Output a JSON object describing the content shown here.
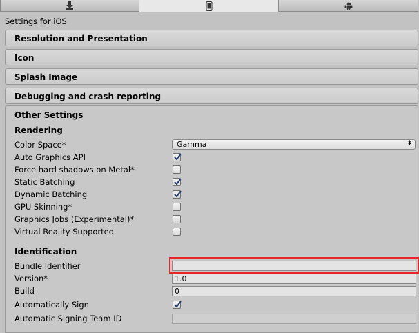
{
  "tabs": [
    {
      "icon": "download-icon"
    },
    {
      "icon": "mobile-phone-icon",
      "active": true
    },
    {
      "icon": "android-icon"
    }
  ],
  "title": "Settings for iOS",
  "sections": {
    "resolution": "Resolution and Presentation",
    "icon": "Icon",
    "splash": "Splash Image",
    "debugging": "Debugging and crash reporting",
    "other": "Other Settings"
  },
  "rendering": {
    "heading": "Rendering",
    "color_space_label": "Color Space*",
    "color_space_value": "Gamma",
    "items": [
      {
        "label": "Auto Graphics API",
        "checked": true
      },
      {
        "label": "Force hard shadows on Metal*",
        "checked": false
      },
      {
        "label": "Static Batching",
        "checked": true
      },
      {
        "label": "Dynamic Batching",
        "checked": true
      },
      {
        "label": "GPU Skinning*",
        "checked": false
      },
      {
        "label": "Graphics Jobs (Experimental)*",
        "checked": false
      },
      {
        "label": "Virtual Reality Supported",
        "checked": false
      }
    ]
  },
  "identification": {
    "heading": "Identification",
    "bundle_identifier_label": "Bundle Identifier",
    "bundle_identifier_value": "",
    "version_label": "Version*",
    "version_value": "1.0",
    "build_label": "Build",
    "build_value": "0",
    "auto_sign_label": "Automatically Sign",
    "auto_sign_checked": true,
    "team_id_label": "Automatic Signing Team ID",
    "team_id_value": ""
  },
  "colors": {
    "highlight": "#e8262a",
    "background": "#c2c2c2"
  }
}
